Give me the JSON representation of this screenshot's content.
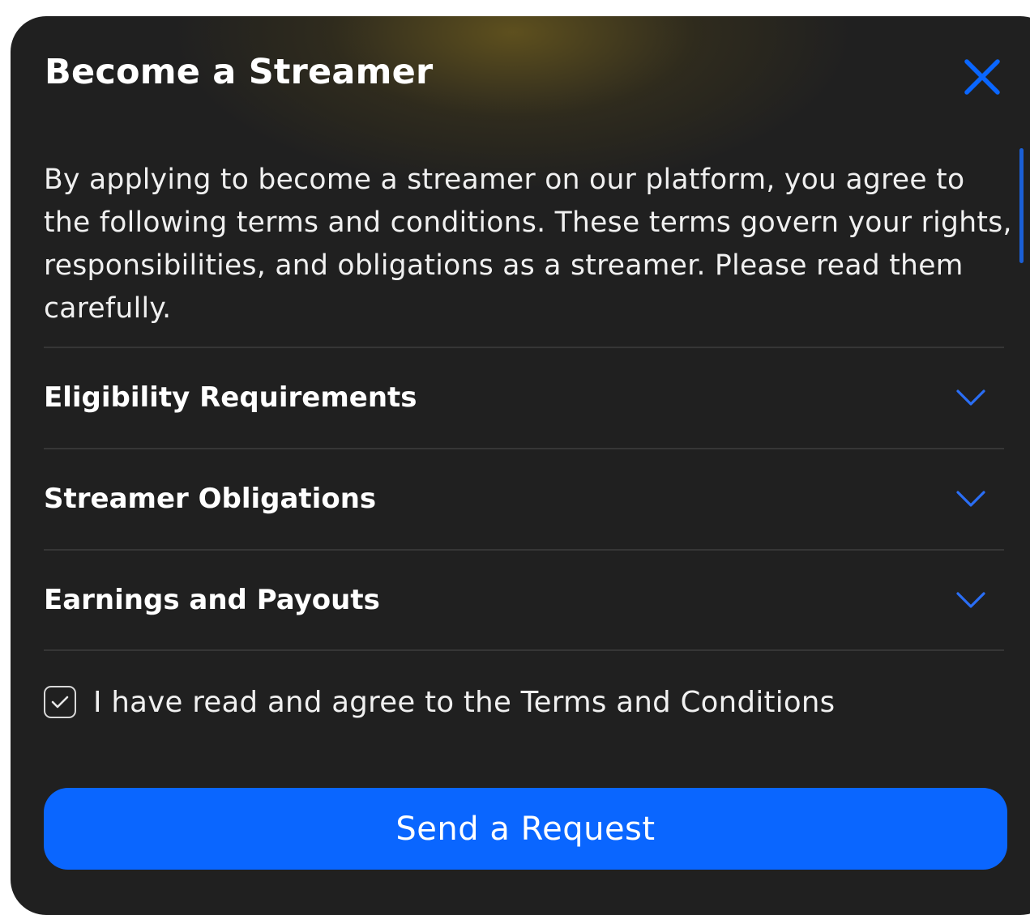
{
  "modal": {
    "title": "Become a Streamer",
    "close_icon": "close-icon",
    "intro_text": "By applying to become a streamer on our platform, you agree to the following terms and conditions. These terms govern your rights, responsibilities, and obligations as a streamer. Please read them carefully.",
    "sections": [
      {
        "label": "Eligibility Requirements",
        "icon": "chevron-down-icon",
        "expanded": false
      },
      {
        "label": "Streamer Obligations",
        "icon": "chevron-down-icon",
        "expanded": false
      },
      {
        "label": "Earnings and Payouts",
        "icon": "chevron-down-icon",
        "expanded": false
      }
    ],
    "agree": {
      "checked": true,
      "label": "I have read and agree to the Terms and Conditions"
    },
    "submit_label": "Send a Request"
  },
  "colors": {
    "background": "#202020",
    "accent": "#0a66ff",
    "text": "#ffffff",
    "divider": "#363636",
    "glow": "#786420"
  }
}
